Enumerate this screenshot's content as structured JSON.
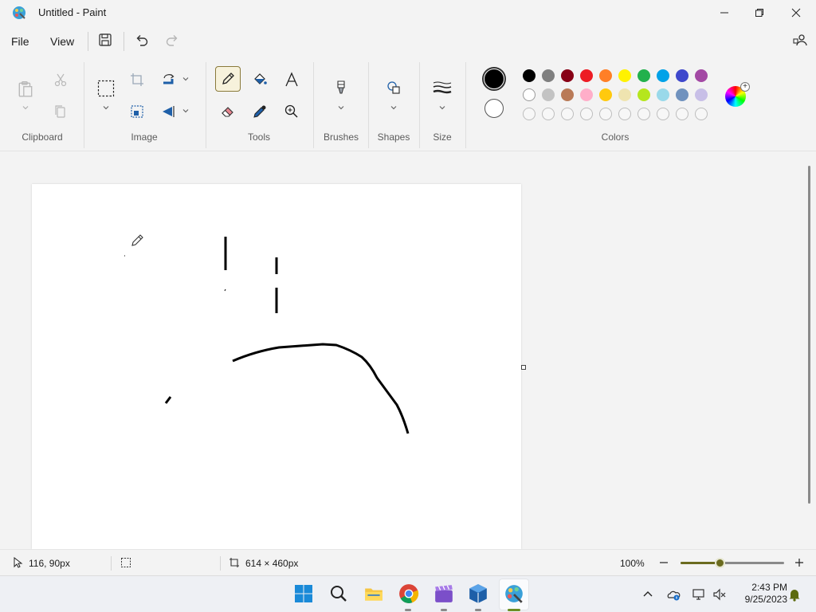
{
  "window": {
    "title": "Untitled - Paint",
    "minimize_icon": "minimize-icon",
    "maximize_icon": "restore-icon",
    "close_icon": "close-icon"
  },
  "menu": {
    "file": "File",
    "view": "View"
  },
  "ribbon": {
    "groups": {
      "clipboard": "Clipboard",
      "image": "Image",
      "tools": "Tools",
      "brushes": "Brushes",
      "shapes": "Shapes",
      "size": "Size",
      "colors": "Colors"
    },
    "active_tool": "pencil"
  },
  "colors": {
    "primary": "#000000",
    "secondary": "#ffffff",
    "palette_row1": [
      "#000000",
      "#7f7f7f",
      "#880015",
      "#ed1c24",
      "#ff7f27",
      "#fff200",
      "#22b14c",
      "#00a2e8",
      "#3f48cc",
      "#a349a4"
    ],
    "palette_row2": [
      "#ffffff",
      "#c3c3c3",
      "#b97a57",
      "#ffaec9",
      "#ffc90e",
      "#efe4b0",
      "#b5e61d",
      "#99d9ea",
      "#7092be",
      "#c8bfe7"
    ],
    "palette_row3_empty_count": 10
  },
  "status": {
    "cursor_position": "116, 90px",
    "canvas_size": "614 × 460px",
    "zoom_level": "100%",
    "zoom_fraction": 0.38
  },
  "taskbar": {
    "time": "2:43 PM",
    "date": "9/25/2023"
  }
}
